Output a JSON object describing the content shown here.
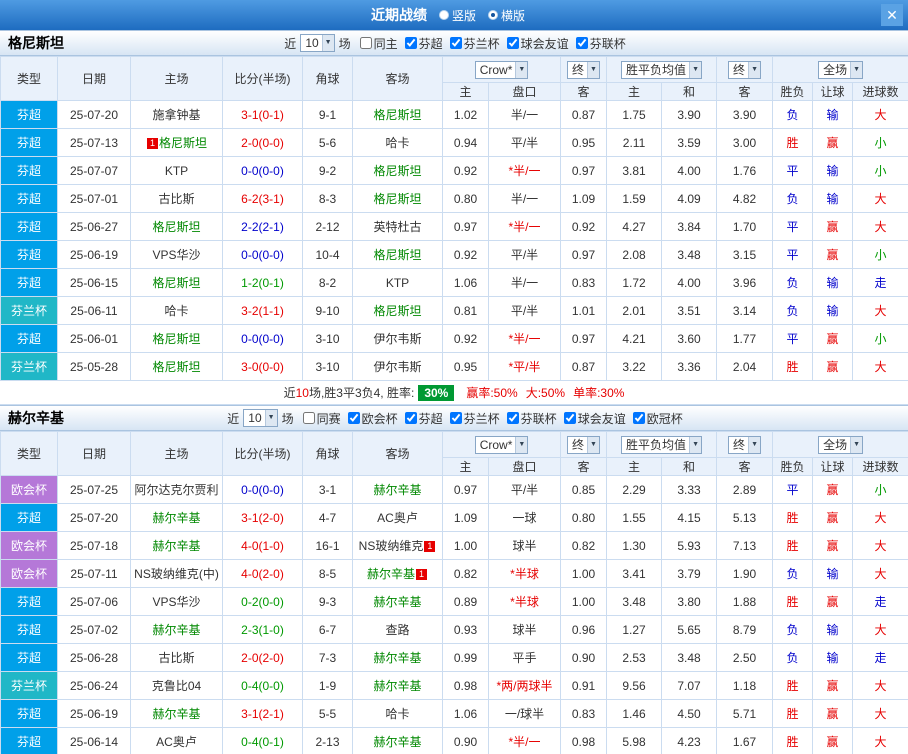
{
  "topbar": {
    "title": "近期战绩",
    "views": [
      {
        "label": "竖版",
        "selected": false
      },
      {
        "label": "横版",
        "selected": true
      }
    ],
    "close_icon": "✕"
  },
  "columns": {
    "type": "类型",
    "date": "日期",
    "home": "主场",
    "score": "比分(半场)",
    "corner": "角球",
    "away": "客场",
    "odds_home": "主",
    "handicap": "盘口",
    "odds_away": "客",
    "avg_home": "主",
    "avg_draw": "和",
    "avg_away": "客",
    "result": "胜负",
    "hcp_result": "让球",
    "goals": "进球数"
  },
  "dropdowns": {
    "company": "Crow*",
    "final1": "终",
    "avg": "胜平负均值",
    "final2": "终",
    "scope": "全场"
  },
  "league_colors": {
    "芬超": "#00a0e9",
    "芬兰杯": "#20b7c7",
    "欧会杯": "#b578d8"
  },
  "palette": {
    "red": "#e60000",
    "blue": "#0000cc",
    "green": "#009900",
    "black": "#333333"
  },
  "value_colors": {
    "胜": "red",
    "平": "blue",
    "负": "blue",
    "赢": "red",
    "输": "blue",
    "走": "blue",
    "大": "red",
    "小": "green"
  },
  "focus_color": "#008800",
  "sections": [
    {
      "team": "格尼斯坦",
      "recent": {
        "prefix": "近",
        "count": "10",
        "suffix": "场"
      },
      "filters": [
        {
          "label": "同主",
          "checked": false
        },
        {
          "label": "芬超",
          "checked": true
        },
        {
          "label": "芬兰杯",
          "checked": true
        },
        {
          "label": "球会友谊",
          "checked": true
        },
        {
          "label": "芬联杯",
          "checked": true
        }
      ],
      "rows": [
        {
          "league": "芬超",
          "date": "25-07-20",
          "home": "施拿钟基",
          "home_focus": false,
          "score": "3-1(0-1)",
          "score_color": "red",
          "corner": "9-1",
          "away": "格尼斯坦",
          "away_focus": true,
          "odds_home": "1.02",
          "handicap": "半/一",
          "odds_away": "0.87",
          "avg_home": "1.75",
          "avg_draw": "3.90",
          "avg_away": "3.90",
          "result": "负",
          "hcp_result": "输",
          "goals": "大"
        },
        {
          "league": "芬超",
          "date": "25-07-13",
          "home": "格尼斯坦",
          "home_focus": true,
          "home_badge": {
            "text": "1",
            "pos": "before"
          },
          "score": "2-0(0-0)",
          "score_color": "red",
          "corner": "5-6",
          "away": "哈卡",
          "away_focus": false,
          "odds_home": "0.94",
          "handicap": "平/半",
          "odds_away": "0.95",
          "avg_home": "2.11",
          "avg_draw": "3.59",
          "avg_away": "3.00",
          "result": "胜",
          "hcp_result": "赢",
          "goals": "小"
        },
        {
          "league": "芬超",
          "date": "25-07-07",
          "home": "KTP",
          "home_focus": false,
          "score": "0-0(0-0)",
          "score_color": "blue",
          "corner": "9-2",
          "away": "格尼斯坦",
          "away_focus": true,
          "odds_home": "0.92",
          "handicap": "*半/一",
          "odds_away": "0.97",
          "avg_home": "3.81",
          "avg_draw": "4.00",
          "avg_away": "1.76",
          "result": "平",
          "hcp_result": "输",
          "goals": "小"
        },
        {
          "league": "芬超",
          "date": "25-07-01",
          "home": "古比斯",
          "home_focus": false,
          "score": "6-2(3-1)",
          "score_color": "red",
          "corner": "8-3",
          "away": "格尼斯坦",
          "away_focus": true,
          "odds_home": "0.80",
          "handicap": "半/一",
          "odds_away": "1.09",
          "avg_home": "1.59",
          "avg_draw": "4.09",
          "avg_away": "4.82",
          "result": "负",
          "hcp_result": "输",
          "goals": "大"
        },
        {
          "league": "芬超",
          "date": "25-06-27",
          "home": "格尼斯坦",
          "home_focus": true,
          "score": "2-2(2-1)",
          "score_color": "blue",
          "corner": "2-12",
          "away": "英特杜古",
          "away_focus": false,
          "odds_home": "0.97",
          "handicap": "*半/一",
          "odds_away": "0.92",
          "avg_home": "4.27",
          "avg_draw": "3.84",
          "avg_away": "1.70",
          "result": "平",
          "hcp_result": "赢",
          "goals": "大"
        },
        {
          "league": "芬超",
          "date": "25-06-19",
          "home": "VPS华沙",
          "home_focus": false,
          "score": "0-0(0-0)",
          "score_color": "blue",
          "corner": "10-4",
          "away": "格尼斯坦",
          "away_focus": true,
          "odds_home": "0.92",
          "handicap": "平/半",
          "odds_away": "0.97",
          "avg_home": "2.08",
          "avg_draw": "3.48",
          "avg_away": "3.15",
          "result": "平",
          "hcp_result": "赢",
          "goals": "小"
        },
        {
          "league": "芬超",
          "date": "25-06-15",
          "home": "格尼斯坦",
          "home_focus": true,
          "score": "1-2(0-1)",
          "score_color": "green",
          "corner": "8-2",
          "away": "KTP",
          "away_focus": false,
          "odds_home": "1.06",
          "handicap": "半/一",
          "odds_away": "0.83",
          "avg_home": "1.72",
          "avg_draw": "4.00",
          "avg_away": "3.96",
          "result": "负",
          "hcp_result": "输",
          "goals": "走"
        },
        {
          "league": "芬兰杯",
          "date": "25-06-11",
          "home": "哈卡",
          "home_focus": false,
          "score": "3-2(1-1)",
          "score_color": "red",
          "corner": "9-10",
          "away": "格尼斯坦",
          "away_focus": true,
          "odds_home": "0.81",
          "handicap": "平/半",
          "odds_away": "1.01",
          "avg_home": "2.01",
          "avg_draw": "3.51",
          "avg_away": "3.14",
          "result": "负",
          "hcp_result": "输",
          "goals": "大"
        },
        {
          "league": "芬超",
          "date": "25-06-01",
          "home": "格尼斯坦",
          "home_focus": true,
          "score": "0-0(0-0)",
          "score_color": "blue",
          "corner": "3-10",
          "away": "伊尔韦斯",
          "away_focus": false,
          "odds_home": "0.92",
          "handicap": "*半/一",
          "odds_away": "0.97",
          "avg_home": "4.21",
          "avg_draw": "3.60",
          "avg_away": "1.77",
          "result": "平",
          "hcp_result": "赢",
          "goals": "小"
        },
        {
          "league": "芬兰杯",
          "date": "25-05-28",
          "home": "格尼斯坦",
          "home_focus": true,
          "score": "3-0(0-0)",
          "score_color": "red",
          "corner": "3-10",
          "away": "伊尔韦斯",
          "away_focus": false,
          "odds_home": "0.95",
          "handicap": "*平/半",
          "odds_away": "0.87",
          "avg_home": "3.22",
          "avg_draw": "3.36",
          "avg_away": "2.04",
          "result": "胜",
          "hcp_result": "赢",
          "goals": "大"
        }
      ],
      "summary": [
        {
          "text": "近",
          "color": "#333333"
        },
        {
          "text": "10",
          "color": "#e60000"
        },
        {
          "text": "场,胜3平3负4, 胜率:",
          "color": "#333333"
        },
        {
          "text": "30%",
          "badge": true
        },
        {
          "text": "赢率:50%",
          "color": "#e60000",
          "stat": true
        },
        {
          "text": "大:50%",
          "color": "#e60000",
          "stat": true
        },
        {
          "text": "单率:30%",
          "color": "#e60000",
          "stat": true
        }
      ]
    },
    {
      "team": "赫尔辛基",
      "recent": {
        "prefix": "近",
        "count": "10",
        "suffix": "场"
      },
      "filters": [
        {
          "label": "同赛",
          "checked": false
        },
        {
          "label": "欧会杯",
          "checked": true
        },
        {
          "label": "芬超",
          "checked": true
        },
        {
          "label": "芬兰杯",
          "checked": true
        },
        {
          "label": "芬联杯",
          "checked": true
        },
        {
          "label": "球会友谊",
          "checked": true
        },
        {
          "label": "欧冠杯",
          "checked": true
        }
      ],
      "rows": [
        {
          "league": "欧会杯",
          "date": "25-07-25",
          "home": "阿尔达克尔贾利",
          "home_focus": false,
          "score": "0-0(0-0)",
          "score_color": "blue",
          "corner": "3-1",
          "away": "赫尔辛基",
          "away_focus": true,
          "odds_home": "0.97",
          "handicap": "平/半",
          "odds_away": "0.85",
          "avg_home": "2.29",
          "avg_draw": "3.33",
          "avg_away": "2.89",
          "result": "平",
          "hcp_result": "赢",
          "goals": "小"
        },
        {
          "league": "芬超",
          "date": "25-07-20",
          "home": "赫尔辛基",
          "home_focus": true,
          "score": "3-1(2-0)",
          "score_color": "red",
          "corner": "4-7",
          "away": "AC奥卢",
          "away_focus": false,
          "odds_home": "1.09",
          "handicap": "一球",
          "odds_away": "0.80",
          "avg_home": "1.55",
          "avg_draw": "4.15",
          "avg_away": "5.13",
          "result": "胜",
          "hcp_result": "赢",
          "goals": "大"
        },
        {
          "league": "欧会杯",
          "date": "25-07-18",
          "home": "赫尔辛基",
          "home_focus": true,
          "score": "4-0(1-0)",
          "score_color": "red",
          "corner": "16-1",
          "away": "NS玻纳维克",
          "away_focus": false,
          "away_badge": {
            "text": "1",
            "pos": "after"
          },
          "odds_home": "1.00",
          "handicap": "球半",
          "odds_away": "0.82",
          "avg_home": "1.30",
          "avg_draw": "5.93",
          "avg_away": "7.13",
          "result": "胜",
          "hcp_result": "赢",
          "goals": "大"
        },
        {
          "league": "欧会杯",
          "date": "25-07-11",
          "home": "NS玻纳维克(中)",
          "home_focus": false,
          "score": "4-0(2-0)",
          "score_color": "red",
          "corner": "8-5",
          "away": "赫尔辛基",
          "away_focus": true,
          "away_badge": {
            "text": "1",
            "pos": "after"
          },
          "odds_home": "0.82",
          "handicap": "*半球",
          "odds_away": "1.00",
          "avg_home": "3.41",
          "avg_draw": "3.79",
          "avg_away": "1.90",
          "result": "负",
          "hcp_result": "输",
          "goals": "大"
        },
        {
          "league": "芬超",
          "date": "25-07-06",
          "home": "VPS华沙",
          "home_focus": false,
          "score": "0-2(0-0)",
          "score_color": "green",
          "corner": "9-3",
          "away": "赫尔辛基",
          "away_focus": true,
          "odds_home": "0.89",
          "handicap": "*半球",
          "odds_away": "1.00",
          "avg_home": "3.48",
          "avg_draw": "3.80",
          "avg_away": "1.88",
          "result": "胜",
          "hcp_result": "赢",
          "goals": "走"
        },
        {
          "league": "芬超",
          "date": "25-07-02",
          "home": "赫尔辛基",
          "home_focus": true,
          "score": "2-3(1-0)",
          "score_color": "green",
          "corner": "6-7",
          "away": "查路",
          "away_focus": false,
          "odds_home": "0.93",
          "handicap": "球半",
          "odds_away": "0.96",
          "avg_home": "1.27",
          "avg_draw": "5.65",
          "avg_away": "8.79",
          "result": "负",
          "hcp_result": "输",
          "goals": "大"
        },
        {
          "league": "芬超",
          "date": "25-06-28",
          "home": "古比斯",
          "home_focus": false,
          "score": "2-0(2-0)",
          "score_color": "red",
          "corner": "7-3",
          "away": "赫尔辛基",
          "away_focus": true,
          "odds_home": "0.99",
          "handicap": "平手",
          "odds_away": "0.90",
          "avg_home": "2.53",
          "avg_draw": "3.48",
          "avg_away": "2.50",
          "result": "负",
          "hcp_result": "输",
          "goals": "走"
        },
        {
          "league": "芬兰杯",
          "date": "25-06-24",
          "home": "克鲁比04",
          "home_focus": false,
          "score": "0-4(0-0)",
          "score_color": "green",
          "corner": "1-9",
          "away": "赫尔辛基",
          "away_focus": true,
          "odds_home": "0.98",
          "handicap": "*两/两球半",
          "odds_away": "0.91",
          "avg_home": "9.56",
          "avg_draw": "7.07",
          "avg_away": "1.18",
          "result": "胜",
          "hcp_result": "赢",
          "goals": "大"
        },
        {
          "league": "芬超",
          "date": "25-06-19",
          "home": "赫尔辛基",
          "home_focus": true,
          "score": "3-1(2-1)",
          "score_color": "red",
          "corner": "5-5",
          "away": "哈卡",
          "away_focus": false,
          "odds_home": "1.06",
          "handicap": "一/球半",
          "odds_away": "0.83",
          "avg_home": "1.46",
          "avg_draw": "4.50",
          "avg_away": "5.71",
          "result": "胜",
          "hcp_result": "赢",
          "goals": "大"
        },
        {
          "league": "芬超",
          "date": "25-06-14",
          "home": "AC奥卢",
          "home_focus": false,
          "score": "0-4(0-1)",
          "score_color": "green",
          "corner": "2-13",
          "away": "赫尔辛基",
          "away_focus": true,
          "odds_home": "0.90",
          "handicap": "*半/一",
          "odds_away": "0.98",
          "avg_home": "5.98",
          "avg_draw": "4.23",
          "avg_away": "1.67",
          "result": "胜",
          "hcp_result": "赢",
          "goals": "大"
        }
      ]
    }
  ]
}
